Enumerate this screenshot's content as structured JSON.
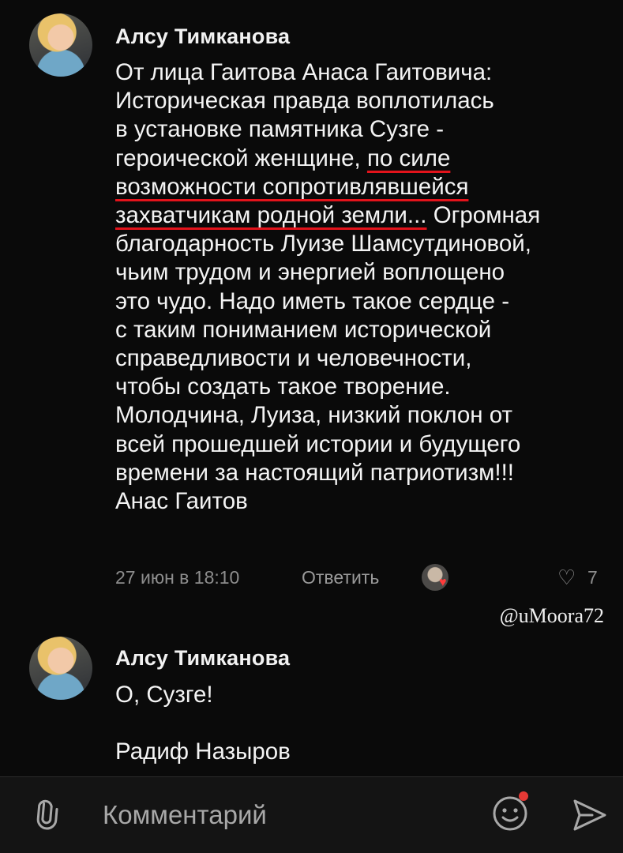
{
  "comments": [
    {
      "author": "Алсу Тимканова",
      "lines": [
        "От лица Гаитова Анаса Гаитовича:",
        "Историческая правда воплотилась",
        "в установке памятника Сузге -",
        "героической женщине, ",
        "по силе",
        "возможности сопротивлявшейся",
        "захватчикам родной земли...",
        " Огромная",
        "благодарность Луизе Шамсутдиновой,",
        "чьим трудом и энергией воплощено",
        "это чудо. Надо иметь такое сердце -",
        "с таким  пониманием исторической",
        "справедливости и человечности,",
        "чтобы создать такое творение.",
        "Молодчина, Луиза, низкий поклон от",
        "всей прошедшей истории и будущего",
        "времени за настоящий патриотизм!!!",
        "Анас Гаитов"
      ],
      "date": "27 июн в 18:10",
      "reply_label": "Ответить",
      "like_count": "7"
    },
    {
      "author": "Алсу Тимканова",
      "lines": [
        "О, Сузге!",
        "",
        "Радиф Назыров"
      ]
    }
  ],
  "watermark": "@uMoora72",
  "composer": {
    "placeholder": "Комментарий",
    "attach_icon": "paperclip-icon",
    "emoji_icon": "smile-icon",
    "send_icon": "send-icon",
    "accent_color": "#e3131b"
  }
}
